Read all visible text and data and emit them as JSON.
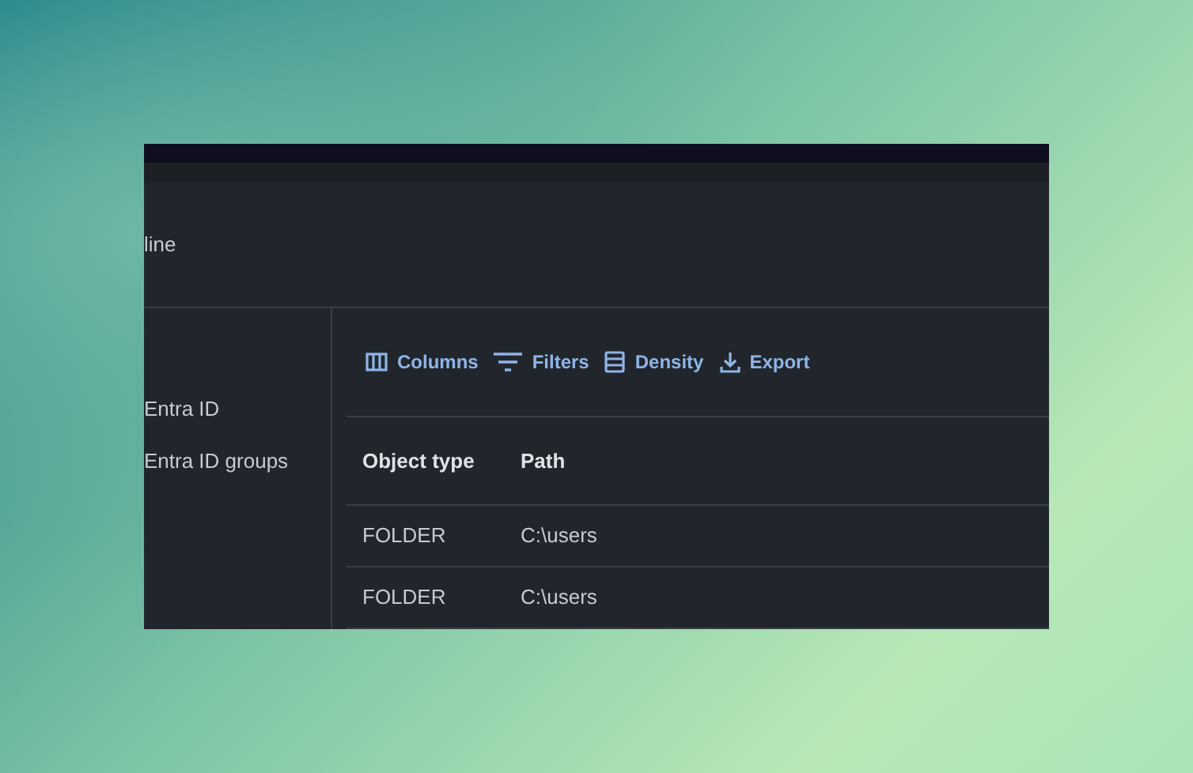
{
  "header": {
    "title": "line"
  },
  "sidebar": {
    "items": [
      {
        "label": "Entra ID"
      },
      {
        "label": "Entra ID groups"
      }
    ]
  },
  "toolbar": [
    {
      "kind": "columns",
      "label": "Columns"
    },
    {
      "kind": "filters",
      "label": "Filters"
    },
    {
      "kind": "density",
      "label": "Density"
    },
    {
      "kind": "export",
      "label": "Export"
    }
  ],
  "table": {
    "columns": [
      "Object type",
      "Path"
    ],
    "rows": [
      [
        "FOLDER",
        "C:\\users"
      ],
      [
        "FOLDER",
        "C:\\users"
      ]
    ]
  }
}
